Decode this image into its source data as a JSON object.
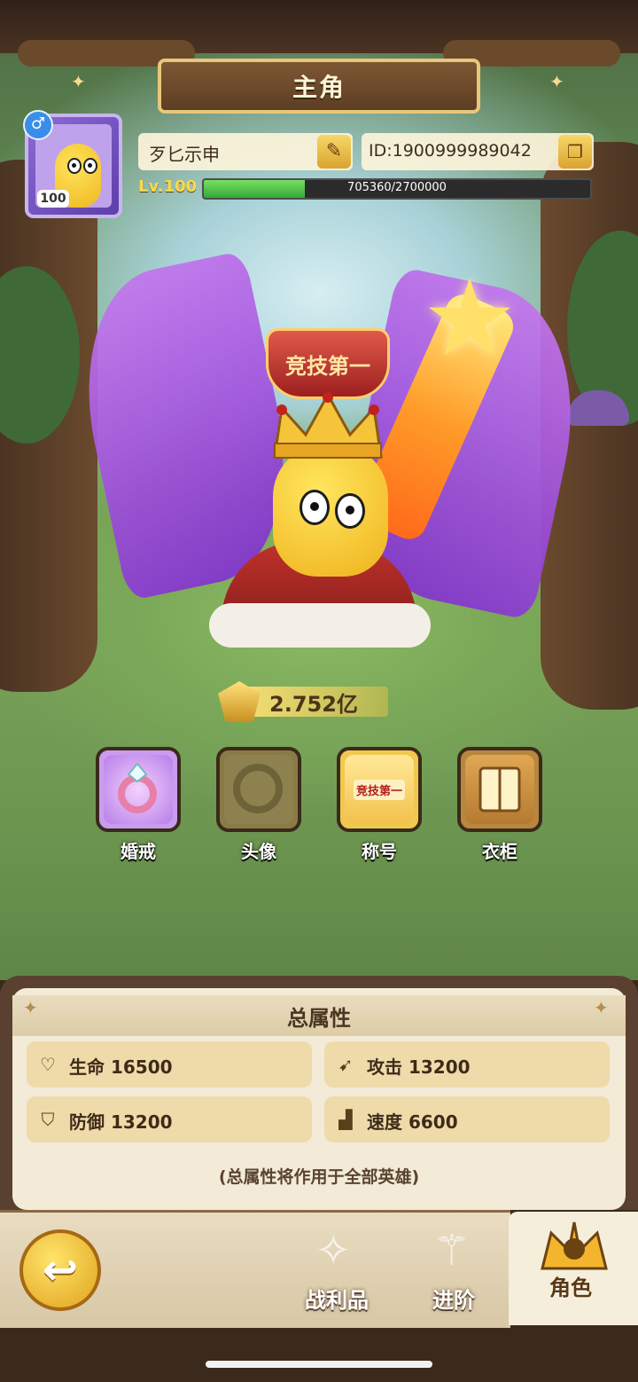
{
  "header": {
    "title": "主角"
  },
  "player": {
    "name": "歹匕示申",
    "id_text": "ID:1900999989042",
    "level_label": "Lv.100",
    "avatar_level": "100",
    "gender_symbol": "♂",
    "xp_text": "705360/2700000",
    "xp_fraction": 0.261
  },
  "hero": {
    "title_badge": "竞技第一",
    "power": "2.752亿"
  },
  "features": [
    {
      "label": "婚戒",
      "icon": "ring-icon"
    },
    {
      "label": "头像",
      "icon": "avatar-frame-icon"
    },
    {
      "label": "称号",
      "icon": "title-badge-icon"
    },
    {
      "label": "衣柜",
      "icon": "wardrobe-icon"
    }
  ],
  "feature_badge_text": "竞技第一",
  "attributes": {
    "title": "总属性",
    "items": [
      {
        "label": "生命 16500",
        "icon": "heart-icon"
      },
      {
        "label": "攻击 13200",
        "icon": "attack-icon"
      },
      {
        "label": "防御 13200",
        "icon": "shield-icon"
      },
      {
        "label": "速度 6600",
        "icon": "boot-icon"
      }
    ],
    "note": "(总属性将作用于全部英雄)"
  },
  "tabs": [
    {
      "label": "战利品",
      "icon": "loot-icon"
    },
    {
      "label": "进阶",
      "icon": "advance-icon"
    },
    {
      "label": "角色",
      "icon": "character-icon",
      "active": true
    }
  ],
  "colors": {
    "accent_gold": "#f8d76a",
    "xp_green": "#4cc94a",
    "panel_bg": "#f3ebd7"
  }
}
